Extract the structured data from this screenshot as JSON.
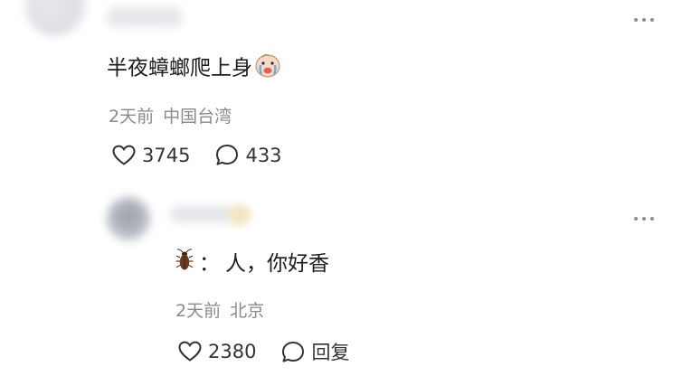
{
  "comment": {
    "text": "半夜蟑螂爬上身",
    "time": "2天前",
    "location": "中国台湾",
    "likes": "3745",
    "replies": "433"
  },
  "reply": {
    "speaker_sep": "：",
    "text": "人，你好香",
    "time": "2天前",
    "location": "北京",
    "likes": "2380",
    "reply_label": "回复"
  },
  "colors": {
    "text_primary": "#1c1c1c",
    "text_secondary": "#8a8a8a",
    "icon": "#333333"
  },
  "icons": {
    "emoji": "crying-face-emoji-icon",
    "roach": "cockroach-emoji-icon",
    "like": "heart-outline-icon",
    "comment": "speech-bubble-icon",
    "more": "more-dots-icon"
  }
}
